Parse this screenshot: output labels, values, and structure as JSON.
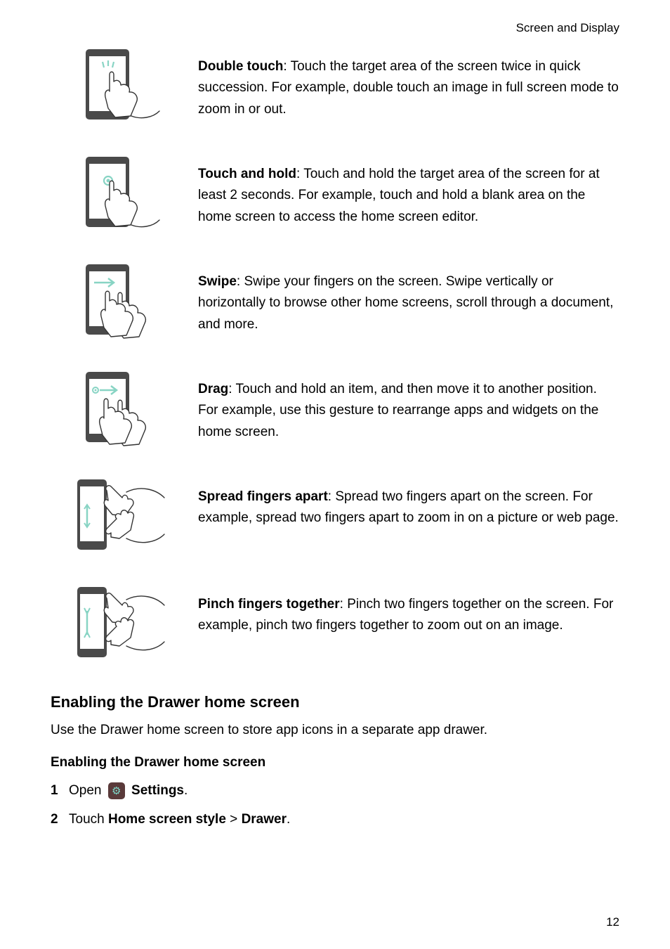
{
  "header": {
    "section_title": "Screen and Display"
  },
  "gestures": [
    {
      "title": "Double touch",
      "desc": ": Touch the target area of the screen twice in quick succession. For example, double touch an image in full screen mode to zoom in or out."
    },
    {
      "title": "Touch and hold",
      "desc": ": Touch and hold the target area of the screen for at least 2 seconds. For example, touch and hold a blank area on the home screen to access the home screen editor."
    },
    {
      "title": "Swipe",
      "desc": ": Swipe your fingers on the screen. Swipe vertically or horizontally to browse other home screens, scroll through a document, and more."
    },
    {
      "title": "Drag",
      "desc": ": Touch and hold an item, and then move it to another position. For example, use this gesture to rearrange apps and widgets on the home screen."
    },
    {
      "title": "Spread fingers apart",
      "desc": ": Spread two fingers apart on the screen. For example, spread two fingers apart to zoom in on a picture or web page."
    },
    {
      "title": "Pinch fingers together",
      "desc": ": Pinch two fingers together on the screen. For example, pinch two fingers together to zoom out on an image."
    }
  ],
  "drawer": {
    "heading": "Enabling the Drawer home screen",
    "intro": "Use the Drawer home screen to store app icons in a separate app drawer.",
    "subheading": "Enabling the Drawer home screen",
    "steps": {
      "s1_num": "1",
      "s1_open": "Open ",
      "s1_settings": "Settings",
      "s1_period": ".",
      "s2_num": "2",
      "s2_touch": "Touch ",
      "s2_hss": "Home screen style",
      "s2_gt": " > ",
      "s2_drawer": "Drawer",
      "s2_period": "."
    }
  },
  "page_number": "12"
}
